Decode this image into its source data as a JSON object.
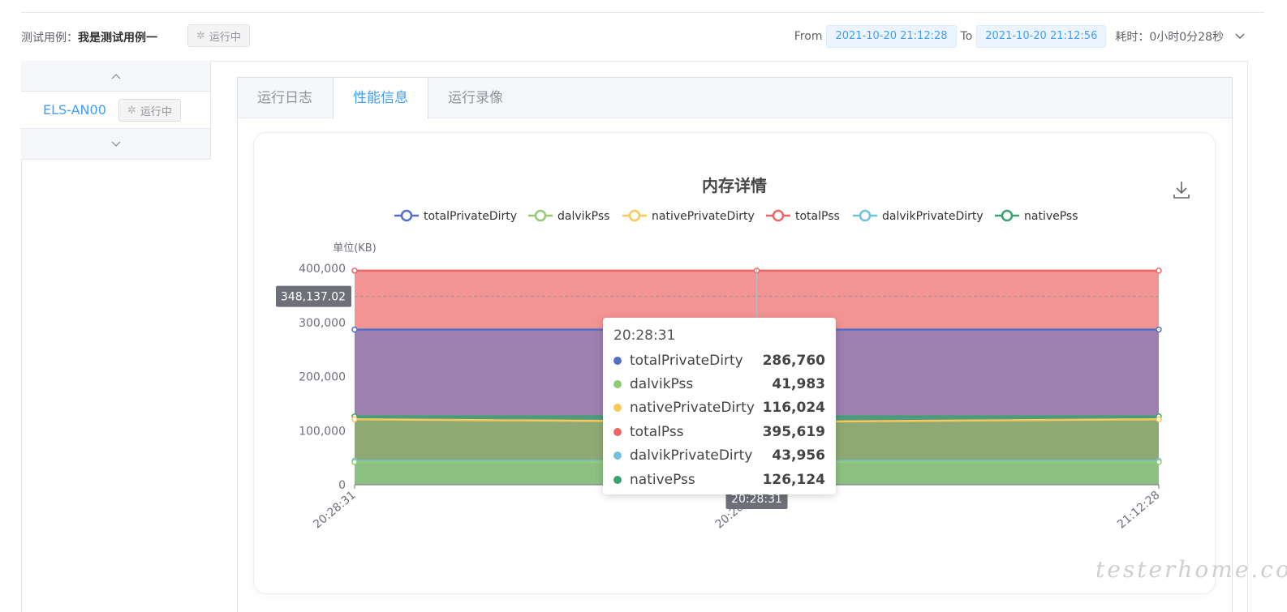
{
  "header": {
    "case_prefix": "测试用例：",
    "case_name": "我是测试用例一",
    "status": "运行中",
    "from_label": "From",
    "from_time": "2021-10-20 21:12:28",
    "to_label": "To",
    "to_time": "2021-10-20 21:12:56",
    "duration": "耗时：0小时0分28秒"
  },
  "sidebar": {
    "device_name": "ELS-AN00",
    "device_status": "运行中"
  },
  "tabs": [
    {
      "label": "运行日志"
    },
    {
      "label": "性能信息"
    },
    {
      "label": "运行录像"
    }
  ],
  "tooltip": {
    "title": "20:28:31",
    "rows": [
      {
        "name": "totalPrivateDirty",
        "value": "286,760",
        "color": "#5470c6"
      },
      {
        "name": "dalvikPss",
        "value": "41,983",
        "color": "#91cc75"
      },
      {
        "name": "nativePrivateDirty",
        "value": "116,024",
        "color": "#fac858"
      },
      {
        "name": "totalPss",
        "value": "395,619",
        "color": "#ee6666"
      },
      {
        "name": "dalvikPrivateDirty",
        "value": "43,956",
        "color": "#73c0de"
      },
      {
        "name": "nativePss",
        "value": "126,124",
        "color": "#3ba272"
      }
    ]
  },
  "watermark": "testerhome.com",
  "chart_data": {
    "type": "area",
    "title": "内存详情",
    "ylabel": "单位(KB)",
    "xlabel": "",
    "ylim": [
      0,
      400000
    ],
    "yticks": [
      "0",
      "100,000",
      "200,000",
      "300,000",
      "400,000"
    ],
    "x": [
      "20:28:31",
      "20:28:31",
      "21:12:28"
    ],
    "axis_pointer": {
      "y_label": "348,137.02",
      "x_label": "20:28:31"
    },
    "legend_position": "top",
    "grid": "dashed horizontal pointer only",
    "series": [
      {
        "name": "totalPrivateDirty",
        "color": "#5470c6",
        "values": [
          286760,
          286760,
          286760
        ]
      },
      {
        "name": "dalvikPss",
        "color": "#91cc75",
        "values": [
          41983,
          41983,
          41983
        ]
      },
      {
        "name": "nativePrivateDirty",
        "color": "#fac858",
        "values": [
          121000,
          116024,
          121000
        ]
      },
      {
        "name": "totalPss",
        "color": "#ee6666",
        "values": [
          395619,
          395619,
          395619
        ]
      },
      {
        "name": "dalvikPrivateDirty",
        "color": "#73c0de",
        "values": [
          43956,
          43956,
          43956
        ]
      },
      {
        "name": "nativePss",
        "color": "#3ba272",
        "values": [
          126124,
          126124,
          126124
        ]
      }
    ]
  }
}
